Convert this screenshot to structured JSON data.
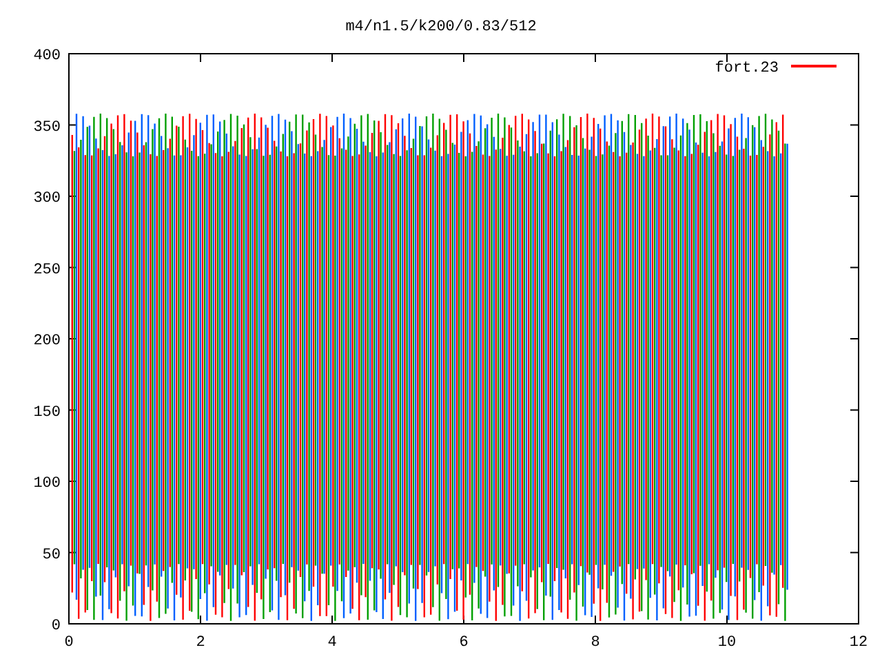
{
  "plot": {
    "title": "m4/n1.5/k200/0.83/512",
    "y_axis_labels": [
      "400",
      "350",
      "300",
      "250",
      "200",
      "150",
      "100",
      "50",
      "0"
    ],
    "x_axis_labels": [
      "0",
      "2",
      "4",
      "6",
      "8",
      "10",
      "12"
    ],
    "legend": {
      "label": "fort.23",
      "color": "#ff0000"
    }
  }
}
